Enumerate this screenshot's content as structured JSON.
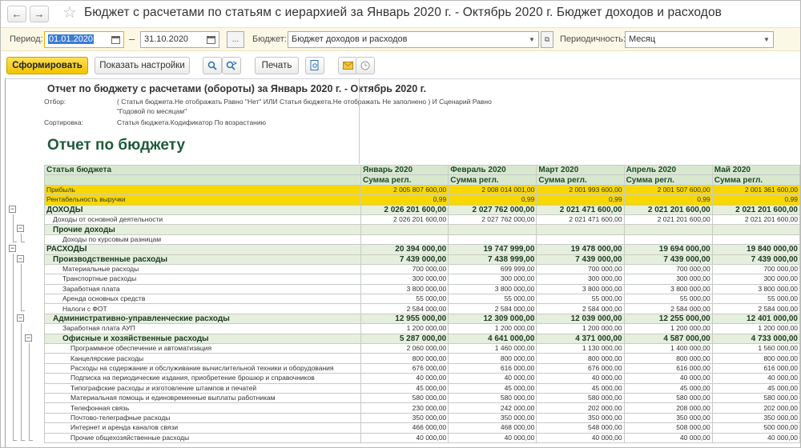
{
  "window": {
    "title": "Бюджет с расчетами по статьям с иерархией за Январь 2020 г. - Октябрь 2020 г. Бюджет доходов и расходов",
    "back_glyph": "←",
    "forward_glyph": "→",
    "star_glyph": "☆"
  },
  "filters": {
    "period_label": "Период:",
    "period_from": "01.01.2020",
    "dash": "–",
    "period_to": "31.10.2020",
    "ellipsis": "...",
    "budget_label": "Бюджет:",
    "budget_value": "Бюджет доходов и расходов",
    "periodicity_label": "Периодичность:",
    "periodicity_value": "Месяц"
  },
  "toolbar": {
    "generate": "Сформировать",
    "show_settings": "Показать настройки",
    "print": "Печать"
  },
  "report": {
    "header_title": "Отчет по бюджету с расчетами (обороты)  за Январь 2020 г. - Октябрь 2020 г.",
    "filter_key": "Отбор:",
    "filter_line1": "( Статья бюджета.Не отображать Равно \"Нет\" ИЛИ Статья бюджета.Не отображать Не заполнено ) И Сценарий Равно",
    "filter_line2": "\"Годовой по месяцам\"",
    "sort_key": "Сортировка:",
    "sort_value": "Статья бюджета.Кодификатор По возрастанию",
    "big_title": "Отчет по бюджету",
    "col_article": "Статья бюджета",
    "months": [
      "Январь 2020",
      "Февраль 2020",
      "Март 2020",
      "Апрель 2020",
      "Май 2020"
    ],
    "sub_label": "Сумма регл.",
    "rows": [
      {
        "type": "hy",
        "level": 0,
        "label": "Прибыль",
        "values": [
          "2 005 807 600,00",
          "2 008 014 001,00",
          "2 001 993 600,00",
          "2 001 507 600,00",
          "2 001 361 600,00"
        ]
      },
      {
        "type": "hy",
        "level": 0,
        "label": "Рентабельность выручки",
        "values": [
          "0,99",
          "0,99",
          "0,99",
          "0,99",
          "0,99"
        ]
      },
      {
        "type": "g1",
        "level": 0,
        "label": "ДОХОДЫ",
        "values": [
          "2 026 201 600,00",
          "2 027 762 000,00",
          "2 021 471 600,00",
          "2 021 201 600,00",
          "2 021 201 600,00"
        ]
      },
      {
        "type": "leaf",
        "level": 1,
        "label": "Доходы от основной деятельности",
        "values": [
          "2 026 201 600,00",
          "2 027 762 000,00",
          "2 021 471 600,00",
          "2 021 201 600,00",
          "2 021 201 600,00"
        ]
      },
      {
        "type": "g2",
        "level": 1,
        "label": "Прочие доходы",
        "values": [
          "",
          "",
          "",
          "",
          ""
        ]
      },
      {
        "type": "leaf",
        "level": 2,
        "label": "Доходы по курсовым разницам",
        "values": [
          "",
          "",
          "",
          "",
          ""
        ]
      },
      {
        "type": "g1",
        "level": 0,
        "label": "РАСХОДЫ",
        "values": [
          "20 394 000,00",
          "19 747 999,00",
          "19 478 000,00",
          "19 694 000,00",
          "19 840 000,00"
        ]
      },
      {
        "type": "g2",
        "level": 1,
        "label": "Производственные расходы",
        "values": [
          "7 439 000,00",
          "7 438 999,00",
          "7 439 000,00",
          "7 439 000,00",
          "7 439 000,00"
        ]
      },
      {
        "type": "leaf",
        "level": 2,
        "label": "Материальные расходы",
        "values": [
          "700 000,00",
          "699 999,00",
          "700 000,00",
          "700 000,00",
          "700 000,00"
        ]
      },
      {
        "type": "leaf",
        "level": 2,
        "label": "Транспортные расходы",
        "values": [
          "300 000,00",
          "300 000,00",
          "300 000,00",
          "300 000,00",
          "300 000,00"
        ]
      },
      {
        "type": "leaf",
        "level": 2,
        "label": "Заработная плата",
        "values": [
          "3 800 000,00",
          "3 800 000,00",
          "3 800 000,00",
          "3 800 000,00",
          "3 800 000,00"
        ]
      },
      {
        "type": "leaf",
        "level": 2,
        "label": "Аренда основных средств",
        "values": [
          "55 000,00",
          "55 000,00",
          "55 000,00",
          "55 000,00",
          "55 000,00"
        ]
      },
      {
        "type": "leaf",
        "level": 2,
        "label": "Налоги с ФОТ",
        "values": [
          "2 584 000,00",
          "2 584 000,00",
          "2 584 000,00",
          "2 584 000,00",
          "2 584 000,00"
        ]
      },
      {
        "type": "g2",
        "level": 1,
        "label": "Административно-управленческие расходы",
        "values": [
          "12 955 000,00",
          "12 309 000,00",
          "12 039 000,00",
          "12 255 000,00",
          "12 401 000,00"
        ]
      },
      {
        "type": "leaf",
        "level": 2,
        "label": "Заработная плата АУП",
        "values": [
          "1 200 000,00",
          "1 200 000,00",
          "1 200 000,00",
          "1 200 000,00",
          "1 200 000,00"
        ]
      },
      {
        "type": "g2",
        "level": 2,
        "label": "Офисные и хозяйственные расходы",
        "values": [
          "5 287 000,00",
          "4 641 000,00",
          "4 371 000,00",
          "4 587 000,00",
          "4 733 000,00"
        ]
      },
      {
        "type": "leaf",
        "level": 3,
        "label": "Программное обеспечение и автоматизация",
        "values": [
          "2 060 000,00",
          "1 460 000,00",
          "1 130 000,00",
          "1 400 000,00",
          "1 560 000,00"
        ]
      },
      {
        "type": "leaf",
        "level": 3,
        "label": "Канцелярские расходы",
        "values": [
          "800 000,00",
          "800 000,00",
          "800 000,00",
          "800 000,00",
          "800 000,00"
        ]
      },
      {
        "type": "leaf",
        "level": 3,
        "label": "Расходы на содержание и обслуживание вычислительной техники и оборудования",
        "values": [
          "676 000,00",
          "616 000,00",
          "676 000,00",
          "616 000,00",
          "616 000,00"
        ]
      },
      {
        "type": "leaf",
        "level": 3,
        "label": "Подписка на периодические издания, приобретение брошюр и справочников",
        "values": [
          "40 000,00",
          "40 000,00",
          "40 000,00",
          "40 000,00",
          "40 000,00"
        ]
      },
      {
        "type": "leaf",
        "level": 3,
        "label": "Типографские расходы и изготовление штампов и печатей",
        "values": [
          "45 000,00",
          "45 000,00",
          "45 000,00",
          "45 000,00",
          "45 000,00"
        ]
      },
      {
        "type": "leaf",
        "level": 3,
        "label": "Материальная помощь и единовременные выплаты работникам",
        "values": [
          "580 000,00",
          "580 000,00",
          "580 000,00",
          "580 000,00",
          "580 000,00"
        ]
      },
      {
        "type": "leaf",
        "level": 3,
        "label": "Телефонная связь",
        "values": [
          "230 000,00",
          "242 000,00",
          "202 000,00",
          "208 000,00",
          "202 000,00"
        ]
      },
      {
        "type": "leaf",
        "level": 3,
        "label": "Почтово-телеграфные расходы",
        "values": [
          "350 000,00",
          "350 000,00",
          "350 000,00",
          "350 000,00",
          "350 000,00"
        ]
      },
      {
        "type": "leaf",
        "level": 3,
        "label": "Интернет и аренда каналов связи",
        "values": [
          "466 000,00",
          "468 000,00",
          "548 000,00",
          "508 000,00",
          "500 000,00"
        ]
      },
      {
        "type": "leaf",
        "level": 3,
        "label": "Прочие общехозяйственные расходы",
        "values": [
          "40 000,00",
          "40 000,00",
          "40 000,00",
          "40 000,00",
          "40 000,00"
        ]
      }
    ]
  },
  "icons": [
    "back-arrow-icon",
    "forward-arrow-icon",
    "favorite-star-icon",
    "calendar-icon",
    "dropdown-arrow-icon",
    "open-form-icon",
    "search-icon",
    "search-next-icon",
    "print-preview-icon",
    "email-icon",
    "clock-icon",
    "tree-collapse-icon"
  ]
}
